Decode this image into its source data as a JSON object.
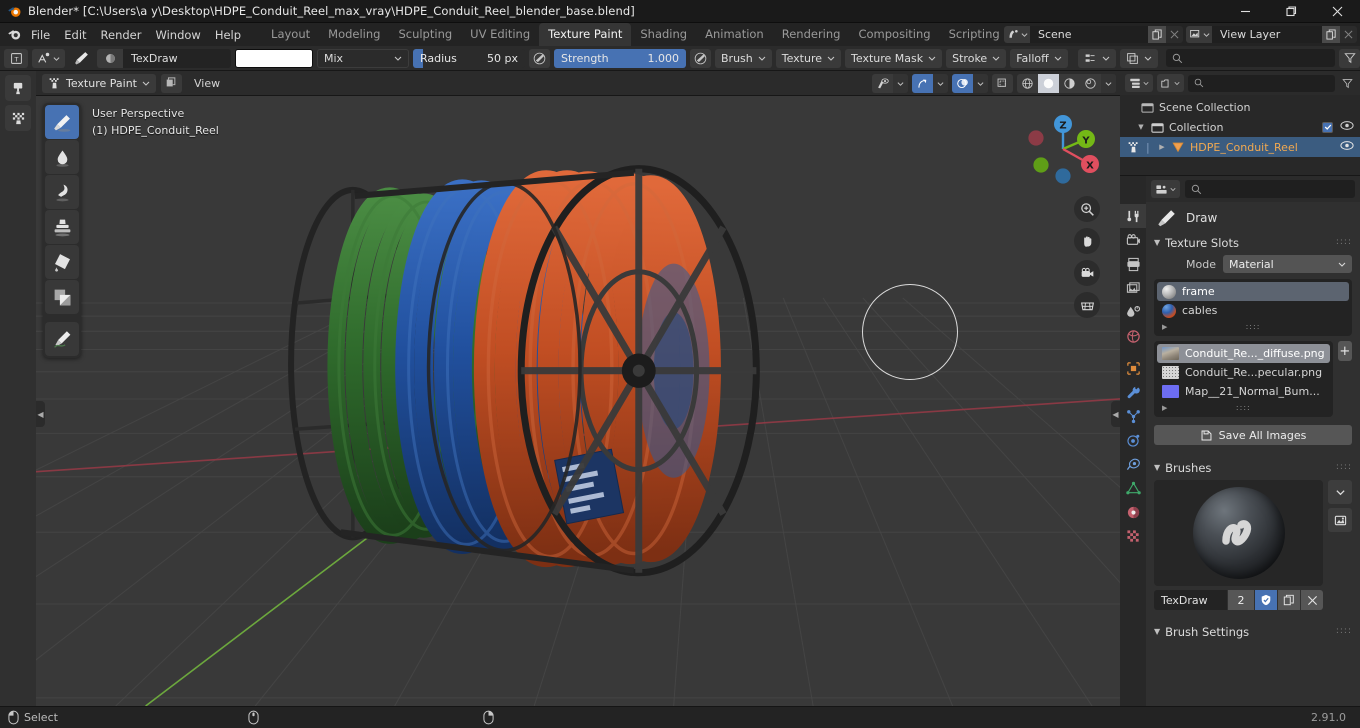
{
  "titlebar": {
    "text": "Blender* [C:\\Users\\a y\\Desktop\\HDPE_Conduit_Reel_max_vray\\HDPE_Conduit_Reel_blender_base.blend]",
    "minimize": "–",
    "maximize": "❐",
    "close": "✕"
  },
  "topbar": {
    "menus": [
      "File",
      "Edit",
      "Render",
      "Window",
      "Help"
    ],
    "workspaces": [
      {
        "label": "Layout",
        "active": false
      },
      {
        "label": "Modeling",
        "active": false
      },
      {
        "label": "Sculpting",
        "active": false
      },
      {
        "label": "UV Editing",
        "active": false
      },
      {
        "label": "Texture Paint",
        "active": true
      },
      {
        "label": "Shading",
        "active": false
      },
      {
        "label": "Animation",
        "active": false
      },
      {
        "label": "Rendering",
        "active": false
      },
      {
        "label": "Compositing",
        "active": false
      },
      {
        "label": "Scripting",
        "active": false
      }
    ],
    "add_workspace": "+",
    "scene_name": "Scene",
    "view_layer_name": "View Layer"
  },
  "tool_settings": {
    "brush_name": "TexDraw",
    "color_swatch": "#ffffff",
    "blend_mode": "Mix",
    "radius_label": "Radius",
    "radius_value": "50 px",
    "radius_fill_pct": 9,
    "strength_label": "Strength",
    "strength_value": "1.000",
    "strength_fill_pct": 100,
    "popovers": [
      "Brush",
      "Texture",
      "Texture Mask",
      "Stroke",
      "Falloff"
    ]
  },
  "viewport_header": {
    "mode": "Texture Paint",
    "view_menu": "View"
  },
  "viewport": {
    "overlay_line1": "User Perspective",
    "overlay_line2": "(1) HDPE_Conduit_Reel",
    "tools": [
      {
        "name": "draw-tool",
        "active": true
      },
      {
        "name": "soften-tool",
        "active": false
      },
      {
        "name": "smear-tool",
        "active": false
      },
      {
        "name": "clone-tool",
        "active": false
      },
      {
        "name": "fill-tool",
        "active": false
      },
      {
        "name": "mask-tool",
        "active": false
      },
      {
        "name": "annotate-tool",
        "active": false
      }
    ],
    "gizmo_axes": [
      {
        "label": "Z",
        "color": "#4296d9"
      },
      {
        "label": "Y",
        "color": "#74b816"
      },
      {
        "label": "X",
        "color": "#e04f5f"
      }
    ],
    "background_color": "#393939",
    "grid_color": "#484848",
    "axis_x_color": "#9c3b48",
    "axis_y_color": "#7ab648"
  },
  "outliner": {
    "rows": [
      {
        "label": "Scene Collection",
        "icon": "collection-icon",
        "indent": 18,
        "selected": false,
        "has_tri": false,
        "has_check": false,
        "has_eye": false
      },
      {
        "label": "Collection",
        "icon": "collection-icon",
        "indent": 28,
        "selected": false,
        "has_tri": true,
        "has_check": true,
        "has_eye": true
      },
      {
        "label": "HDPE_Conduit_Reel",
        "icon": "mesh-icon",
        "indent": 48,
        "selected": true,
        "has_tri": true,
        "has_check": false,
        "has_eye": true
      }
    ]
  },
  "properties": {
    "active_tool_label": "Draw",
    "texture_slots": {
      "title": "Texture Slots",
      "mode_label": "Mode",
      "mode_value": "Material",
      "materials": [
        {
          "name": "frame",
          "selected": true,
          "color1": "#d9d9d9",
          "color2": "#8a8a8a"
        },
        {
          "name": "cables",
          "selected": false,
          "color1": "#4a7ec8",
          "color2": "#d4592c"
        }
      ],
      "images": [
        {
          "name": "Conduit_Re..._diffuse.png",
          "selected": true,
          "thumb": "#8b8477"
        },
        {
          "name": "Conduit_Re...pecular.png",
          "selected": false,
          "thumb": "#d8d8d8"
        },
        {
          "name": "Map__21_Normal_Bum...",
          "selected": false,
          "thumb": "#6666f0"
        }
      ],
      "save_all_label": "Save All Images"
    },
    "brushes": {
      "title": "Brushes",
      "brush_name": "TexDraw",
      "users_count": "2",
      "fake_user_on": true
    },
    "brush_settings_title": "Brush Settings"
  },
  "statusbar": {
    "select_label": "Select",
    "version": "2.91.0"
  }
}
